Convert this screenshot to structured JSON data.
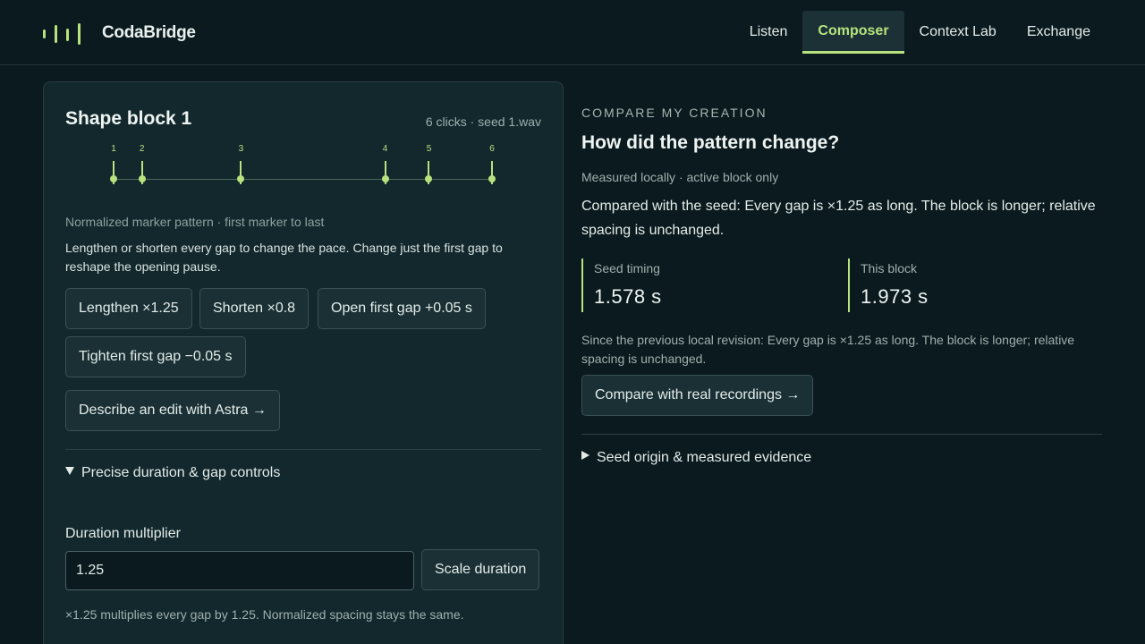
{
  "header": {
    "brand": "CodaBridge",
    "nav": [
      {
        "label": "Listen",
        "active": false
      },
      {
        "label": "Composer",
        "active": true
      },
      {
        "label": "Context Lab",
        "active": false
      },
      {
        "label": "Exchange",
        "active": false
      }
    ]
  },
  "block": {
    "title": "Shape block 1",
    "meta": "6 clicks · seed 1.wav",
    "markers": [
      {
        "label": "1",
        "position": 0.0
      },
      {
        "label": "2",
        "position": 0.0749
      },
      {
        "label": "3",
        "position": 0.3366
      },
      {
        "label": "4",
        "position": 0.7177
      },
      {
        "label": "5",
        "position": 0.8333
      },
      {
        "label": "6",
        "position": 1.0
      }
    ],
    "caption": "Normalized marker pattern · first marker to last",
    "description": "Lengthen or shorten every gap to change the pace. Change just the first gap to reshape the opening pause.",
    "buttons": {
      "lengthen": "Lengthen ×1.25",
      "shorten": "Shorten ×0.8",
      "open_first_gap": "Open first gap +0.05 s",
      "tighten_first_gap": "Tighten first gap −0.05 s",
      "describe_edit": "Describe an edit with Astra →"
    },
    "precise_controls": {
      "summary": "Precise duration & gap controls",
      "expanded": true,
      "duration_label": "Duration multiplier",
      "duration_value": "1.25",
      "scale_button": "Scale duration",
      "hint": "×1.25 multiplies every gap by 1.25. Normalized spacing stays the same."
    }
  },
  "compare": {
    "eyebrow": "COMPARE MY CREATION",
    "title": "How did the pattern change?",
    "subtitle": "Measured locally · active block only",
    "description": "Compared with the seed: Every gap is ×1.25 as long. The block is longer; relative spacing is unchanged.",
    "stats": [
      {
        "label": "Seed timing",
        "value": "1.578 s"
      },
      {
        "label": "This block",
        "value": "1.973 s"
      }
    ],
    "note": "Since the previous local revision: Every gap is ×1.25 as long. The block is longer; relative spacing is unchanged.",
    "compare_button": "Compare with real recordings →",
    "evidence_summary": "Seed origin & measured evidence",
    "evidence_expanded": false
  },
  "colors": {
    "background": "#0b1a1f",
    "panel": "#12282d",
    "accent": "#b7e27e",
    "text": "#e3ece9",
    "muted": "#9fb0ad"
  },
  "icons": {
    "brand_mark": "waveform-bars-icon",
    "expanded": "triangle-down-icon",
    "collapsed": "triangle-right-icon"
  }
}
